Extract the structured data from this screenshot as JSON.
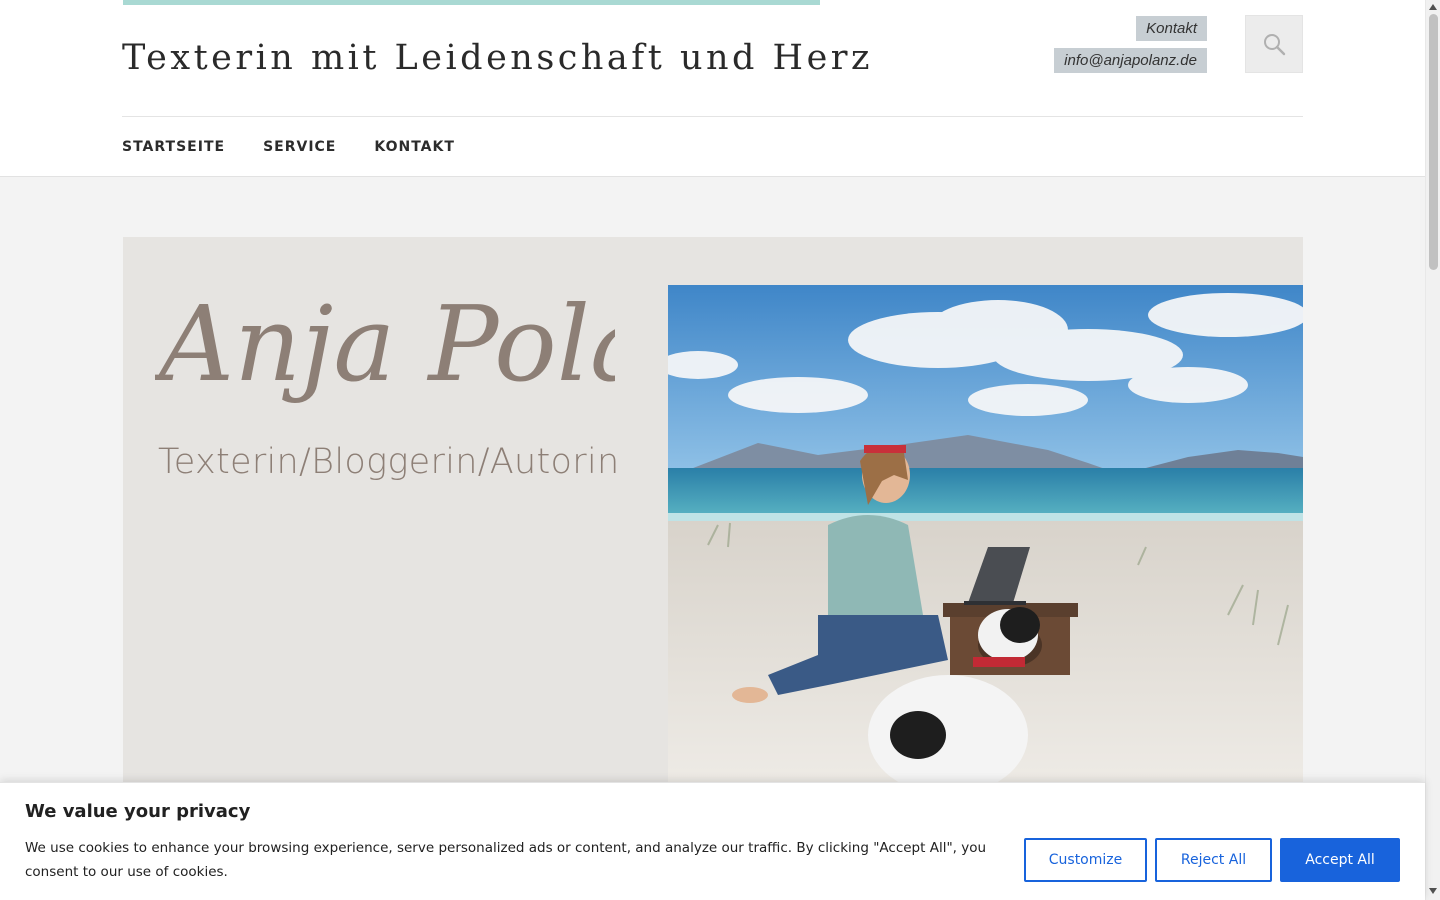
{
  "header": {
    "site_title": "Texterin mit Leidenschaft und Herz",
    "contact_tag": "Kontakt",
    "email_tag": "info@anjapolanz.de",
    "search_icon": "search-icon"
  },
  "nav": {
    "items": [
      "STARTSEITE",
      "SERVICE",
      "KONTAKT"
    ]
  },
  "hero": {
    "name": "Anja Polanz",
    "subtitle": "Texterin/Bloggerin/Autorin",
    "photo": "beach-photo-woman-with-laptop-and-dog"
  },
  "cookie_banner": {
    "title": "We value your privacy",
    "text": "We use cookies to enhance your browsing experience, serve personalized ads or content, and analyze our traffic. By clicking \"Accept All\", you consent to our use of cookies.",
    "customize_label": "Customize",
    "reject_label": "Reject All",
    "accept_label": "Accept All"
  },
  "colors": {
    "accent_bar": "#a9d9d3",
    "tag_background": "#c7ced3",
    "cookie_button": "#1863dc",
    "hero_script": "#8d7f76"
  }
}
